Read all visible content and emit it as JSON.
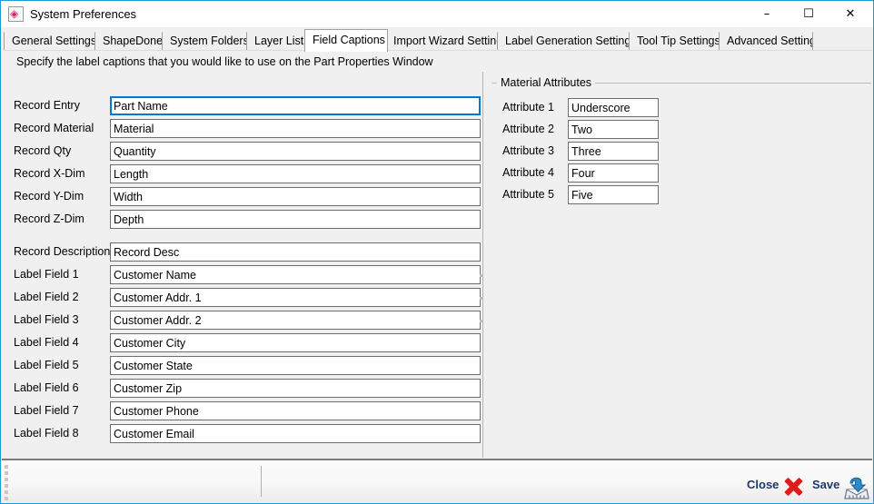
{
  "window": {
    "title": "System Preferences",
    "app_icon": "paint-bucket-icon",
    "minimize_glyph": "–",
    "maximize_glyph": "☐",
    "close_glyph": "✕"
  },
  "tabs": [
    {
      "label": "General Settings",
      "selected": false
    },
    {
      "label": "ShapeDone",
      "selected": false
    },
    {
      "label": "System Folders",
      "selected": false
    },
    {
      "label": "Layer Lists",
      "selected": false
    },
    {
      "label": "Field Captions",
      "selected": true
    },
    {
      "label": "Import Wizard Settings",
      "selected": false
    },
    {
      "label": "Label Generation Settings",
      "selected": false
    },
    {
      "label": "Tool Tip Settings",
      "selected": false
    },
    {
      "label": "Advanced Settings",
      "selected": false
    }
  ],
  "content": {
    "instruction": "Specify the label captions that you would like to use on the Part Properties Window",
    "fields": [
      {
        "label": "Record Entry",
        "value": "Part Name",
        "focused": true
      },
      {
        "label": "Record Material",
        "value": "Material",
        "focused": false
      },
      {
        "label": "Record Qty",
        "value": "Quantity",
        "focused": false
      },
      {
        "label": "Record X-Dim",
        "value": "Length",
        "focused": false
      },
      {
        "label": "Record Y-Dim",
        "value": "Width",
        "focused": false
      },
      {
        "label": "Record Z-Dim",
        "value": "Depth",
        "focused": false
      },
      {
        "label": "Record Description",
        "value": "Record Desc",
        "focused": false
      },
      {
        "label": "Label Field 1",
        "value": "Customer Name",
        "focused": false
      },
      {
        "label": "Label Field 2",
        "value": "Customer Addr. 1",
        "focused": false
      },
      {
        "label": "Label Field 3",
        "value": "Customer Addr. 2",
        "focused": false
      },
      {
        "label": "Label Field 4",
        "value": "Customer City",
        "focused": false
      },
      {
        "label": "Label Field 5",
        "value": "Customer State",
        "focused": false
      },
      {
        "label": "Label Field 6",
        "value": "Customer Zip",
        "focused": false
      },
      {
        "label": "Label Field 7",
        "value": "Customer Phone",
        "focused": false
      },
      {
        "label": "Label Field 8",
        "value": "Customer Email",
        "focused": false
      }
    ],
    "material_attributes": {
      "group_title": "Material Attributes",
      "attributes": [
        {
          "label": "Attribute 1",
          "value": "Underscore"
        },
        {
          "label": "Attribute 2",
          "value": "Two"
        },
        {
          "label": "Attribute 3",
          "value": "Three"
        },
        {
          "label": "Attribute 4",
          "value": "Four"
        },
        {
          "label": "Attribute 5",
          "value": "Five"
        }
      ]
    }
  },
  "statusbar": {
    "close_label": "Close",
    "close_icon": "red-x-icon",
    "save_label": "Save",
    "save_icon": "save-to-disk-icon"
  },
  "colors": {
    "window_border": "#1c9bd8",
    "accent_focus": "#0078d7",
    "close_red": "#e01b19",
    "action_text": "#1f3864",
    "panel_bg": "#f0f0f0",
    "field_border": "#6e6e6e"
  }
}
